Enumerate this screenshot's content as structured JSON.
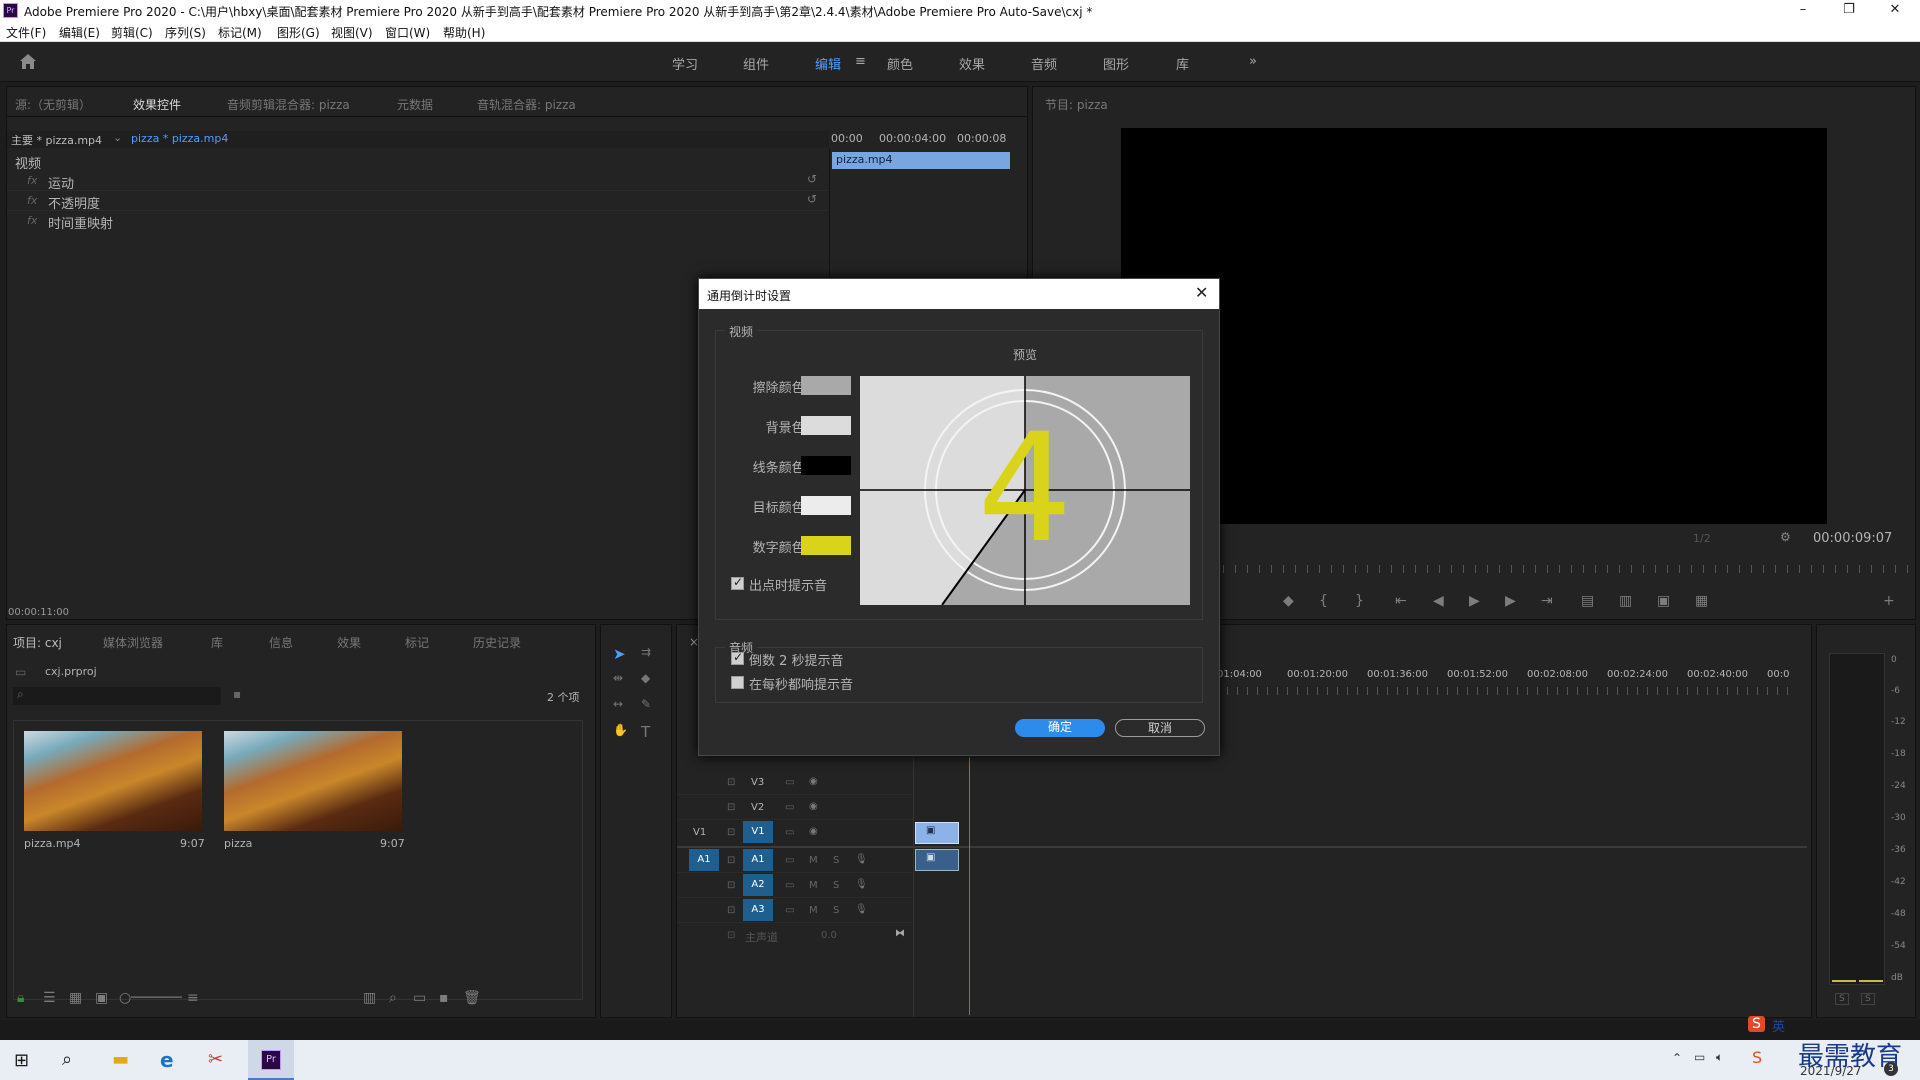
{
  "window": {
    "title": "Adobe Premiere Pro 2020 - C:\\用户\\hbxy\\桌面\\配套素材 Premiere Pro 2020 从新手到高手\\配套素材 Premiere Pro 2020 从新手到高手\\第2章\\2.4.4\\素材\\Adobe Premiere Pro Auto-Save\\cxj *",
    "logo": "Pr",
    "minimize": "–",
    "maximize": "❐",
    "close": "✕"
  },
  "menu": [
    "文件(F)",
    "编辑(E)",
    "剪辑(C)",
    "序列(S)",
    "标记(M)",
    "图形(G)",
    "视图(V)",
    "窗口(W)",
    "帮助(H)"
  ],
  "workspaces": {
    "items": [
      "学习",
      "组件",
      "编辑",
      "颜色",
      "效果",
      "音频",
      "图形",
      "库"
    ],
    "active": "编辑",
    "more": "»",
    "menu_icon": "≡"
  },
  "effect_controls": {
    "tabs": [
      "源:（无剪辑）",
      "效果控件",
      "音频剪辑混合器: pizza",
      "元数据",
      "音轨混合器: pizza"
    ],
    "active_tab": "效果控件",
    "master": "主要 * pizza.mp4",
    "clip": "pizza * pizza.mp4",
    "ruler": [
      "00:00",
      "00:00:04:00",
      "00:00:08"
    ],
    "clip_bar": "pizza.mp4",
    "section": "视频",
    "effects": [
      "运动",
      "不透明度",
      "时间重映射"
    ],
    "fx_label": "fx",
    "timecode": "00:00:11:00"
  },
  "program": {
    "tab": "节目: pizza",
    "timecode": "00:00:09:07",
    "fit": "1/2"
  },
  "project": {
    "tabs": [
      "项目: cxj",
      "媒体浏览器",
      "库",
      "信息",
      "效果",
      "标记",
      "历史记录"
    ],
    "file": "cxj.prproj",
    "count": "2 个项",
    "items": [
      {
        "name": "pizza.mp4",
        "duration": "9:07"
      },
      {
        "name": "pizza",
        "duration": "9:07"
      }
    ]
  },
  "timeline": {
    "ruler": [
      "01:04:00",
      "00:01:20:00",
      "00:01:36:00",
      "00:01:52:00",
      "00:02:08:00",
      "00:02:24:00",
      "00:02:40:00",
      "00:0"
    ],
    "video_tracks": [
      "V3",
      "V2",
      "V1"
    ],
    "audio_tracks": [
      "A1",
      "A2",
      "A3"
    ],
    "source_v": "V1",
    "source_a": "A1",
    "master": "主声道",
    "master_val": "0.0",
    "mute": "M",
    "solo": "S"
  },
  "meter": {
    "scale": [
      "0",
      "-6",
      "-12",
      "-18",
      "-24",
      "-30",
      "-36",
      "-42",
      "-48",
      "-54",
      "dB"
    ],
    "solo_labels": [
      "S",
      "S"
    ]
  },
  "dialog": {
    "title": "通用倒计时设置",
    "video_legend": "视频",
    "preview_label": "预览",
    "colors": [
      {
        "label": "擦除颜色:",
        "color": "#a9a9a9"
      },
      {
        "label": "背景色:",
        "color": "#dcdcdc"
      },
      {
        "label": "线条颜色:",
        "color": "#000000"
      },
      {
        "label": "目标颜色:",
        "color": "#ececec"
      },
      {
        "label": "数字颜色:",
        "color": "#d9d31a"
      }
    ],
    "cue_out": "出点时提示音",
    "audio_legend": "音频",
    "cue_2s": "倒数 2 秒提示音",
    "cue_each": "在每秒都响提示音",
    "ok": "确定",
    "cancel": "取消",
    "preview_number": "4"
  },
  "taskbar": {
    "date": "2021/9/27",
    "ime": "英",
    "watermark": "最需教育",
    "notif_count": "3"
  }
}
